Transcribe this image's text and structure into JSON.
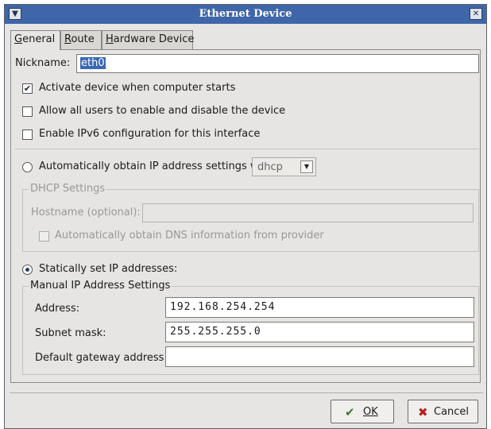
{
  "window": {
    "title": "Ethernet Device",
    "menu_icon": "chevron-down-icon",
    "close_icon": "close-icon"
  },
  "tabs": [
    {
      "label_mnemonic": "G",
      "label_rest": "eneral",
      "active": true
    },
    {
      "label_mnemonic": "R",
      "label_rest": "oute",
      "active": false
    },
    {
      "label_mnemonic": "H",
      "label_rest": "ardware Device",
      "active": false
    }
  ],
  "general": {
    "nickname_label": "Nickname:",
    "nickname_value": "eth0",
    "activate_label": "Activate device when computer starts",
    "activate_checked": true,
    "allow_users_label": "Allow all users to enable and disable the device",
    "allow_users_checked": false,
    "ipv6_label": "Enable IPv6 configuration for this interface",
    "ipv6_checked": false,
    "auto_ip_label": "Automatically obtain IP address settings with:",
    "auto_ip_selected": false,
    "dhcp_option": "dhcp",
    "dhcp_group_title": "DHCP Settings",
    "hostname_label": "Hostname (optional):",
    "hostname_value": "",
    "auto_dns_label": "Automatically obtain DNS information from provider",
    "static_label": "Statically set IP addresses:",
    "static_selected": true,
    "manual_group_title": "Manual IP Address Settings",
    "address_label": "Address:",
    "address_value": "192.168.254.254",
    "subnet_label": "Subnet mask:",
    "subnet_value": "255.255.255.0",
    "gateway_label": "Default gateway address:",
    "gateway_value": ""
  },
  "buttons": {
    "ok_label": "OK",
    "ok_icon": "checkmark-icon",
    "cancel_label": "Cancel",
    "cancel_icon": "cross-icon"
  }
}
